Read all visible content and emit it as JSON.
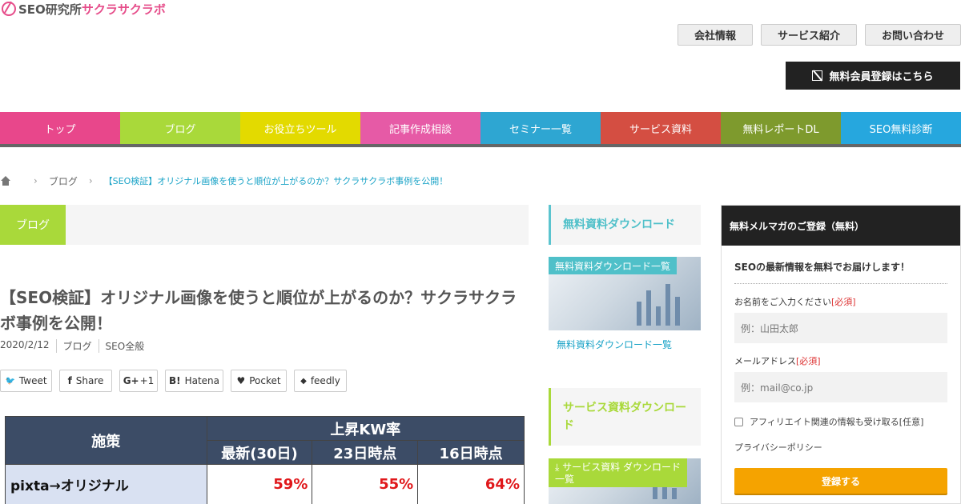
{
  "logo": {
    "part_a": "SEO研究所",
    "part_b": "サクラサクラボ"
  },
  "header": {
    "links": [
      {
        "label": "会社情報"
      },
      {
        "label": "サービス紹介"
      },
      {
        "label": "お問い合わせ"
      }
    ],
    "signup_label": "無料会員登録はこちら"
  },
  "nav": {
    "items": [
      {
        "label": "トップ",
        "color": "#e8478b"
      },
      {
        "label": "ブログ",
        "color": "#a9d93a"
      },
      {
        "label": "お役立ちツール",
        "color": "#e3da00"
      },
      {
        "label": "記事作成相談",
        "color": "#e65aa6"
      },
      {
        "label": "セミナー一覧",
        "color": "#2ea6d2"
      },
      {
        "label": "サービス資料",
        "color": "#d44e42"
      },
      {
        "label": "無料レポートDL",
        "color": "#7e9a2d"
      },
      {
        "label": "SEO無料診断",
        "color": "#26a7de"
      }
    ]
  },
  "breadcrumb": {
    "items": [
      "ブログ"
    ],
    "current": "【SEO検証】オリジナル画像を使うと順位が上がるのか？サクラサクラボ事例を公開！"
  },
  "category": {
    "label": "ブログ"
  },
  "article": {
    "title": "【SEO検証】オリジナル画像を使うと順位が上がるのか？サクラサクラボ事例を公開！",
    "date": "2020/2/12",
    "categories": [
      "ブログ",
      "SEO全般"
    ]
  },
  "share": {
    "buttons": [
      {
        "icon": "twitter-icon",
        "glyph": "🐦",
        "label": "Tweet"
      },
      {
        "icon": "facebook-icon",
        "glyph": "f",
        "label": "Share"
      },
      {
        "icon": "google-plus-icon",
        "glyph": "G+",
        "label": "+1"
      },
      {
        "icon": "hatena-icon",
        "glyph": "B!",
        "label": "Hatena"
      },
      {
        "icon": "pocket-icon",
        "glyph": "♥",
        "label": "Pocket"
      },
      {
        "icon": "feedly-icon",
        "glyph": "◆",
        "label": "feedly"
      }
    ]
  },
  "kw_table": {
    "corner": "施策",
    "group_header": "上昇KW率",
    "columns": [
      "最新(30日)",
      "23日時点",
      "16日時点"
    ],
    "rows": [
      {
        "label": "pixta→オリジナル",
        "values": [
          "59%",
          "55%",
          "64%"
        ]
      }
    ]
  },
  "sidebar": {
    "widget1": {
      "title": "無料資料ダウンロード",
      "image_label": "無料資料ダウンロード一覧",
      "link": "無料資料ダウンロード一覧"
    },
    "widget2": {
      "title_line1": "サービス資料ダウンロー",
      "title_line2": "ド",
      "image_label_line1": "サービス資料 ダウンロード",
      "image_label_line2": "一覧"
    }
  },
  "mailmag": {
    "header": "無料メルマガのご登録（無料）",
    "intro": "SEOの最新情報を無料でお届けします！",
    "name_label": "お名前をご入力ください",
    "name_required": "[必須]",
    "name_placeholder": "例：山田太郎",
    "email_label": "メールアドレス",
    "email_required": "[必須]",
    "email_placeholder": "例：mail@co.jp",
    "affiliate_label": "アフィリエイト関連の情報も受け取る[任意]",
    "privacy": "プライバシーポリシー",
    "submit": "登録する"
  }
}
